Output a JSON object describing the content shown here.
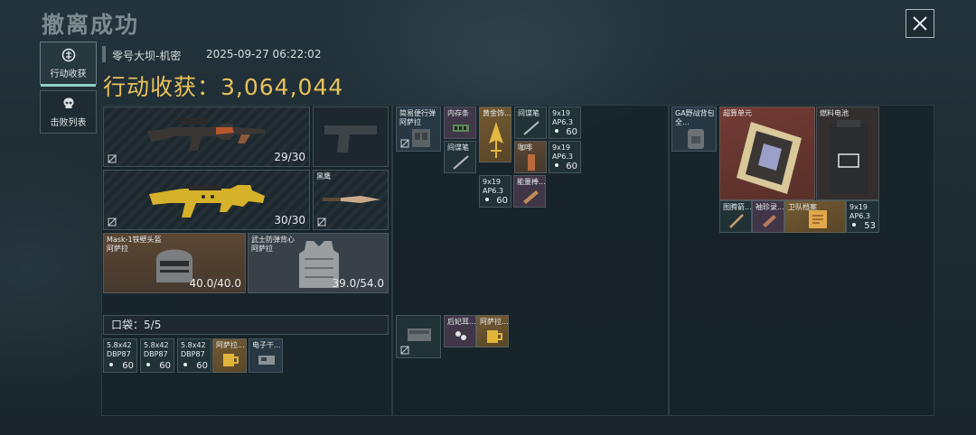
{
  "title": "撤离成功",
  "close_icon": "close-icon",
  "tabs": [
    {
      "label": "行动收获",
      "icon": "loot-icon",
      "active": true
    },
    {
      "label": "击败列表",
      "icon": "skull-icon",
      "active": false
    }
  ],
  "map_name": "零号大坝-机密",
  "timestamp": "2025-09-27 06:22:02",
  "haul": {
    "label": "行动收获：",
    "value": "3,064,044"
  },
  "colors": {
    "accent": "#e8c15a",
    "tab_underline": "#8fd3c4",
    "ammo_green": "#6fbf5a"
  },
  "equipment": {
    "primary_weapon": {
      "icon": "assault-rifle-icon",
      "ammo": "29/30"
    },
    "sidearm": {
      "icon": "pistol-icon"
    },
    "secondary_weapon": {
      "icon": "gold-smg-icon",
      "ammo": "30/30"
    },
    "melee": {
      "name": "黑鹰",
      "icon": "knife-icon"
    },
    "helmet": {
      "name": "Mask-1铁壁头盔",
      "maker": "阿萨拉",
      "durability": "40.0/40.0",
      "icon": "helmet-icon"
    },
    "armor": {
      "name": "武士防弹背心",
      "maker": "阿萨拉",
      "durability": "39.0/54.0",
      "icon": "vest-icon"
    }
  },
  "pocket": {
    "label": "口袋：",
    "value": "5/5"
  },
  "pocket_items": [
    {
      "name": "5.8x42",
      "name2": "DBP87",
      "count": "60",
      "icon": "ammo-icon"
    },
    {
      "name": "5.8x42",
      "name2": "DBP87",
      "count": "60",
      "icon": "ammo-icon"
    },
    {
      "name": "5.8x42",
      "name2": "DBP87",
      "count": "60",
      "icon": "ammo-icon"
    },
    {
      "name": "阿萨拉...",
      "name2": "",
      "count": "",
      "icon": "mug-icon"
    },
    {
      "name": "电子干...",
      "name2": "",
      "count": "",
      "icon": "device-icon"
    }
  ],
  "chest_rig": {
    "name": "简易便行弹",
    "name2": "阿萨拉",
    "icon": "chest-rig-icon",
    "items": [
      {
        "name": "内存条",
        "icon": "memory-icon"
      },
      {
        "name": "黄金饰...",
        "icon": "gold-ornament-icon"
      },
      {
        "name": "间谍笔",
        "icon": "pen-icon"
      },
      {
        "name": "9x19",
        "name2": "AP6.3",
        "count": "60",
        "icon": "ammo-icon"
      },
      {
        "name": "间谍笔",
        "icon": "pen-icon"
      },
      {
        "name": "咖啡",
        "icon": "coffee-icon"
      },
      {
        "name": "9x19",
        "name2": "AP6.3",
        "count": "60",
        "icon": "ammo-icon"
      },
      {
        "name": "9x19",
        "name2": "AP6.3",
        "count": "60",
        "icon": "ammo-icon"
      },
      {
        "name": "能量棒...",
        "icon": "energy-bar-icon"
      }
    ]
  },
  "safe_box": {
    "icon": "safe-box-icon",
    "items": [
      {
        "name": "后妃耳...",
        "icon": "earring-icon"
      },
      {
        "name": "阿萨拉...",
        "icon": "mug-icon"
      }
    ]
  },
  "backpack": {
    "name": "GA野战背包",
    "name2": "全...",
    "icon": "backpack-icon",
    "items": [
      {
        "name": "超算单元",
        "icon": "supercomputer-icon"
      },
      {
        "name": "燃料电池",
        "icon": "fuel-cell-icon"
      },
      {
        "name": "图腾箭...",
        "icon": "arrow-icon"
      },
      {
        "name": "袖珍录...",
        "icon": "recorder-icon"
      },
      {
        "name": "卫队档案",
        "icon": "file-icon"
      },
      {
        "name": "9x19",
        "name2": "AP6.3",
        "count": "53",
        "icon": "ammo-icon"
      }
    ]
  }
}
